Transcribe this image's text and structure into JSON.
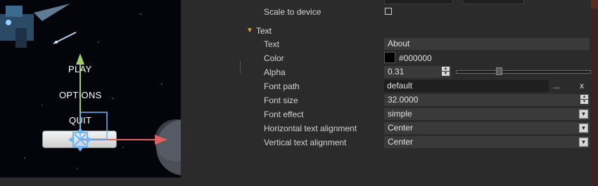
{
  "scene": {
    "menu_items": [
      "PLAY",
      "OPTIONS",
      "QUIT"
    ]
  },
  "inspector": {
    "scale_to_device": {
      "label": "Scale to device",
      "checked": false
    },
    "section_title": "Text",
    "rows": {
      "text": {
        "label": "Text",
        "value": "About"
      },
      "color": {
        "label": "Color",
        "value": "#000000"
      },
      "alpha": {
        "label": "Alpha",
        "value": "0.31",
        "level": 0.31
      },
      "font_path": {
        "label": "Font path",
        "value": "default",
        "browse": "...",
        "clear": "x"
      },
      "font_size": {
        "label": "Font size",
        "value": "32.0000"
      },
      "font_effect": {
        "label": "Font effect",
        "value": "simple"
      },
      "h_align": {
        "label": "Horizontal text alignment",
        "value": "Center"
      },
      "v_align": {
        "label": "Vertical text alignment",
        "value": "Center"
      }
    }
  },
  "colors": {
    "section_arrow": "#e0a040",
    "gizmo_y": "#9fce6c",
    "gizmo_x": "#e06060",
    "gizmo_select": "#69b7ff"
  },
  "icons": {
    "section_toggle": "triangle-down",
    "spin": "up-down-arrows",
    "combo": "chevron-down"
  }
}
